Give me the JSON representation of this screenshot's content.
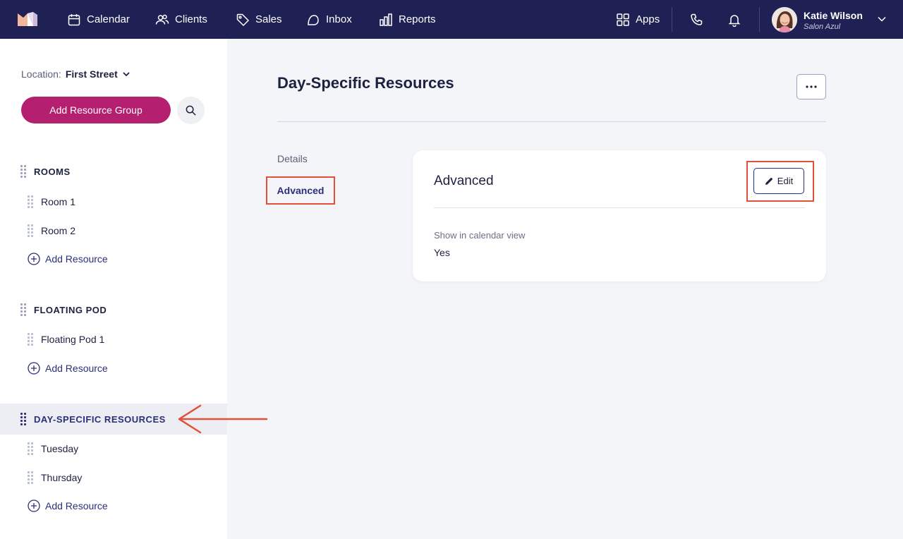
{
  "nav": {
    "items": [
      {
        "label": "Calendar",
        "icon": "calendar-icon"
      },
      {
        "label": "Clients",
        "icon": "users-icon"
      },
      {
        "label": "Sales",
        "icon": "tag-icon"
      },
      {
        "label": "Inbox",
        "icon": "inbox-icon"
      },
      {
        "label": "Reports",
        "icon": "bar-chart-icon"
      }
    ],
    "apps_label": "Apps",
    "user": {
      "name": "Katie Wilson",
      "org": "Salon Azul"
    }
  },
  "sidebar": {
    "location_label": "Location:",
    "location_value": "First Street",
    "add_group_label": "Add Resource Group",
    "add_resource_label": "Add Resource",
    "groups": [
      {
        "name": "ROOMS",
        "items": [
          "Room 1",
          "Room 2"
        ]
      },
      {
        "name": "FLOATING POD",
        "items": [
          "Floating Pod 1"
        ]
      },
      {
        "name": "DAY-SPECIFIC RESOURCES",
        "items": [
          "Tuesday",
          "Thursday"
        ],
        "active": true
      }
    ]
  },
  "main": {
    "title": "Day-Specific Resources",
    "tabs": [
      "Details",
      "Advanced"
    ],
    "active_tab": "Advanced",
    "card": {
      "title": "Advanced",
      "edit_label": "Edit",
      "field_label": "Show in calendar view",
      "field_value": "Yes"
    }
  },
  "colors": {
    "nav_bg": "#1f2154",
    "accent": "#b41f6f",
    "highlight": "#e0503a",
    "link": "#2b2f7a"
  }
}
